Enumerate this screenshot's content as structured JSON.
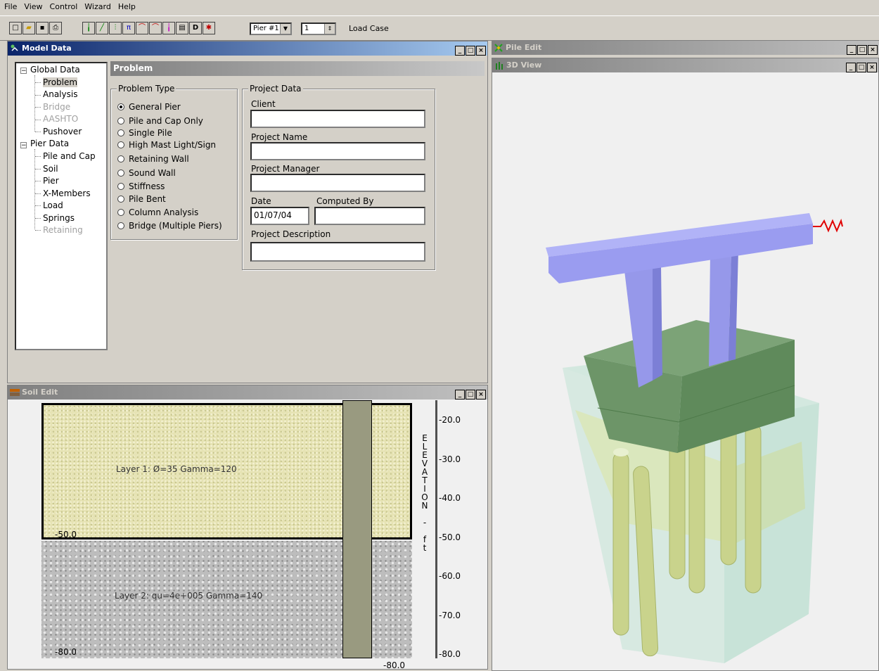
{
  "menu": [
    "File",
    "View",
    "Control",
    "Wizard",
    "Help"
  ],
  "toolbar": {
    "pier_select": "Pier #1",
    "load_case_number": "1",
    "load_case_label": "Load Case"
  },
  "model_window": {
    "title": "Model Data",
    "tree": {
      "global": "Global Data",
      "global_items": [
        {
          "label": "Problem",
          "enabled": true
        },
        {
          "label": "Analysis",
          "enabled": true
        },
        {
          "label": "Bridge",
          "enabled": false
        },
        {
          "label": "AASHTO",
          "enabled": false
        },
        {
          "label": "Pushover",
          "enabled": true
        }
      ],
      "pier": "Pier Data",
      "pier_items": [
        {
          "label": "Pile and Cap",
          "enabled": true
        },
        {
          "label": "Soil",
          "enabled": true
        },
        {
          "label": "Pier",
          "enabled": true
        },
        {
          "label": "X-Members",
          "enabled": true
        },
        {
          "label": "Load",
          "enabled": true
        },
        {
          "label": "Springs",
          "enabled": true
        },
        {
          "label": "Retaining",
          "enabled": false
        }
      ]
    },
    "panel_header": "Problem",
    "problem_type": {
      "label": "Problem Type",
      "options": [
        "General Pier",
        "Pile and Cap Only",
        "Single Pile",
        "High Mast Light/Sign",
        "Retaining Wall",
        "Sound Wall",
        "Stiffness",
        "Pile Bent",
        "Column Analysis",
        "Bridge (Multiple Piers)"
      ],
      "selected": "General Pier"
    },
    "project_data": {
      "label": "Project Data",
      "client_label": "Client",
      "client_value": "",
      "name_label": "Project Name",
      "name_value": "",
      "manager_label": "Project Manager",
      "manager_value": "",
      "date_label": "Date",
      "date_value": "01/07/04",
      "computed_label": "Computed By",
      "computed_value": "",
      "description_label": "Project Description",
      "description_value": ""
    }
  },
  "soil_window": {
    "title": "Soil Edit",
    "layer1": "Layer 1: Ø=35 Gamma=120",
    "layer2": "Layer 2: qu=4e+005 Gamma=140",
    "layer1_bottom": "-50.0",
    "layer2_bottom": "-80.0",
    "pile_bottom": "-80.0",
    "axis_label": "ELEVATION - ft",
    "ticks": [
      "-20.0",
      "-30.0",
      "-40.0",
      "-50.0",
      "-60.0",
      "-70.0",
      "-80.0"
    ]
  },
  "pile_window": {
    "title": "Pile Edit"
  },
  "view3d_window": {
    "title": "3D View"
  },
  "colors": {
    "pier": "#9a9cf0",
    "cap": "#7ea87a",
    "soil_top": "#d8e2a0",
    "soil_box": "#a8dcc8",
    "spring": "#e00000"
  }
}
